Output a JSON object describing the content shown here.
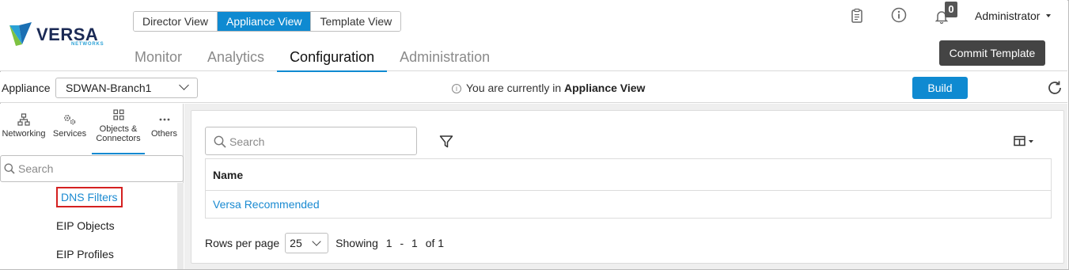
{
  "logo": {
    "brand": "VERSA",
    "sub": "NETWORKS"
  },
  "view_switcher": [
    "Director View",
    "Appliance View",
    "Template View"
  ],
  "active_view": "Appliance View",
  "nav_tabs": [
    "Monitor",
    "Analytics",
    "Configuration",
    "Administration"
  ],
  "active_tab": "Configuration",
  "header": {
    "notification_count": "0",
    "user": "Administrator",
    "commit_label": "Commit Template"
  },
  "appliance_bar": {
    "label": "Appliance",
    "selected": "SDWAN-Branch1",
    "notice_prefix": "You are currently in",
    "notice_bold": "Appliance View",
    "build_label": "Build"
  },
  "left_panel": {
    "categories": [
      {
        "label_line1": "Networking",
        "label_line2": "",
        "icon": "network-icon"
      },
      {
        "label_line1": "Services",
        "label_line2": "",
        "icon": "services-gears-icon"
      },
      {
        "label_line1": "Objects &",
        "label_line2": "Connectors",
        "icon": "objects-grid-icon"
      },
      {
        "label_line1": "Others",
        "label_line2": "",
        "icon": "more-dots-icon"
      }
    ],
    "search_placeholder": "Search",
    "items": [
      "DNS Filters",
      "EIP Objects",
      "EIP Profiles"
    ],
    "selected_item": "DNS Filters"
  },
  "main": {
    "search_placeholder": "Search",
    "table": {
      "header": "Name",
      "rows": [
        "Versa Recommended"
      ]
    },
    "pager": {
      "rows_per_page_label": "Rows per page",
      "rows_per_page": "25",
      "showing_label": "Showing",
      "from": "1",
      "dash": "-",
      "to": "1",
      "of": "of 1"
    }
  },
  "colors": {
    "accent": "#0f8ad1",
    "highlight_box": "#d42020",
    "link": "#1a8ad1"
  }
}
